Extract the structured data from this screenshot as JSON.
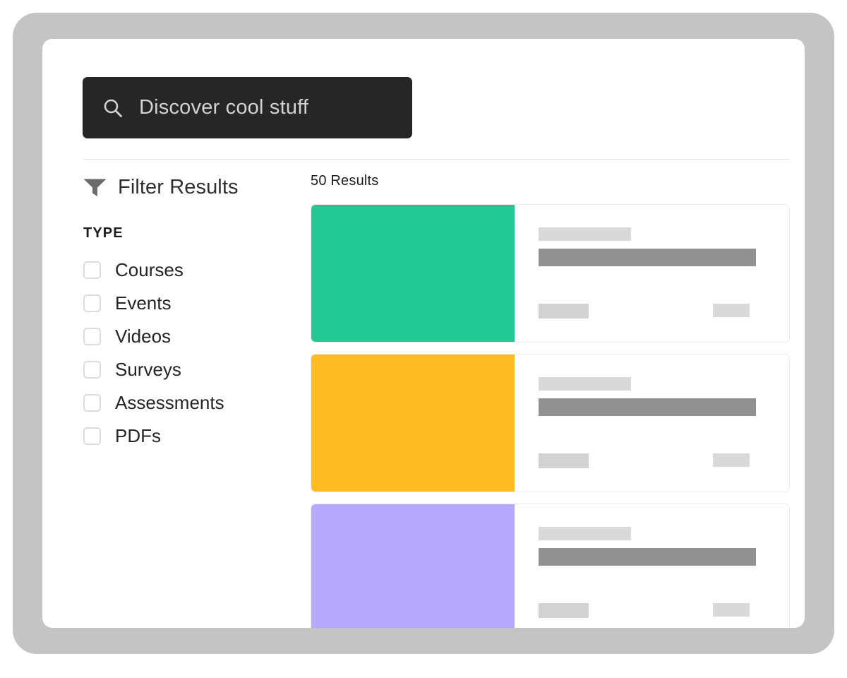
{
  "frame": {
    "outer_color": "#c4c4c4",
    "panel_color": "#ffffff"
  },
  "search": {
    "icon": "search-icon",
    "placeholder": "Discover cool stuff",
    "value": "",
    "background": "#262626",
    "text_color": "#d2d2d2"
  },
  "sidebar": {
    "icon": "funnel-icon",
    "title": "Filter Results",
    "section_heading": "TYPE",
    "options": [
      {
        "label": "Courses",
        "checked": false
      },
      {
        "label": "Events",
        "checked": false
      },
      {
        "label": "Videos",
        "checked": false
      },
      {
        "label": "Surveys",
        "checked": false
      },
      {
        "label": "Assessments",
        "checked": false
      },
      {
        "label": "PDFs",
        "checked": false
      }
    ]
  },
  "results": {
    "count_label": "50 Results",
    "count": 50,
    "cards": [
      {
        "thumb_color": "#22c992",
        "thumb_label": "green-thumbnail"
      },
      {
        "thumb_color": "#ffbb22",
        "thumb_label": "amber-thumbnail"
      },
      {
        "thumb_color": "#b6a8fc",
        "thumb_label": "purple-thumbnail"
      }
    ],
    "placeholder_colors": {
      "title": "#d9d9d9",
      "subtitle": "#919191",
      "meta_left": "#d2d2d2",
      "meta_right": "#d9d9d9"
    }
  }
}
